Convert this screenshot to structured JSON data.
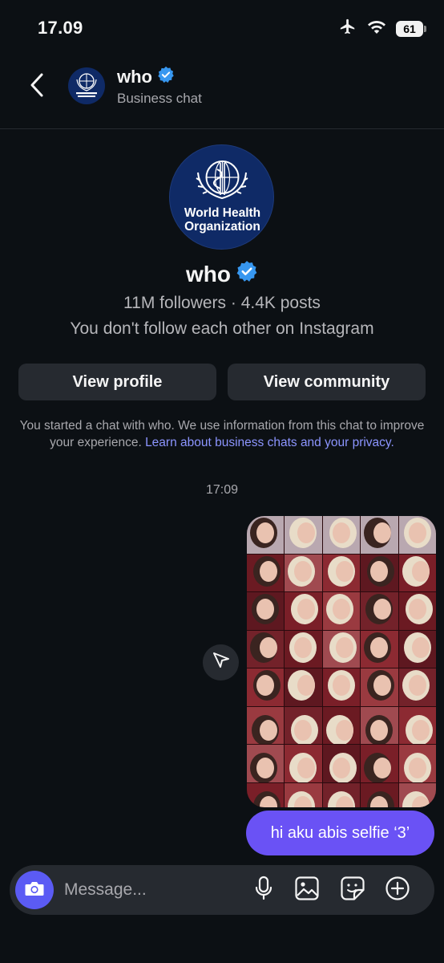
{
  "status_bar": {
    "time": "17.09",
    "battery": "61"
  },
  "header": {
    "name": "who",
    "subtitle": "Business chat"
  },
  "profile": {
    "logo_text": "World Health Organization",
    "name": "who",
    "stats": "11M followers · 4.4K posts",
    "follow_status": "You don't follow each other on Instagram",
    "view_profile_label": "View profile",
    "view_community_label": "View community"
  },
  "notice": {
    "text": "You started a chat with who. We use information from this chat to improve your experience.",
    "link": "Learn about business chats and your privacy."
  },
  "chat": {
    "timestamp": "17:09",
    "messages": [
      {
        "type": "photo",
        "description_icon": "photo-collage"
      },
      {
        "type": "text",
        "text": "hi aku abis selfie ‘3’"
      }
    ]
  },
  "composer": {
    "placeholder": "Message..."
  },
  "colors": {
    "background": "#0c1014",
    "button": "#262a30",
    "accent": "#6a52f5",
    "link": "#8c95ff",
    "verified": "#3797f0"
  },
  "icons": {
    "back": "chevron-left-icon",
    "verified": "verified-badge-icon",
    "share": "send-icon",
    "camera": "camera-icon",
    "mic": "microphone-icon",
    "gallery": "image-icon",
    "sticker": "sticker-icon",
    "plus": "plus-circle-icon"
  }
}
